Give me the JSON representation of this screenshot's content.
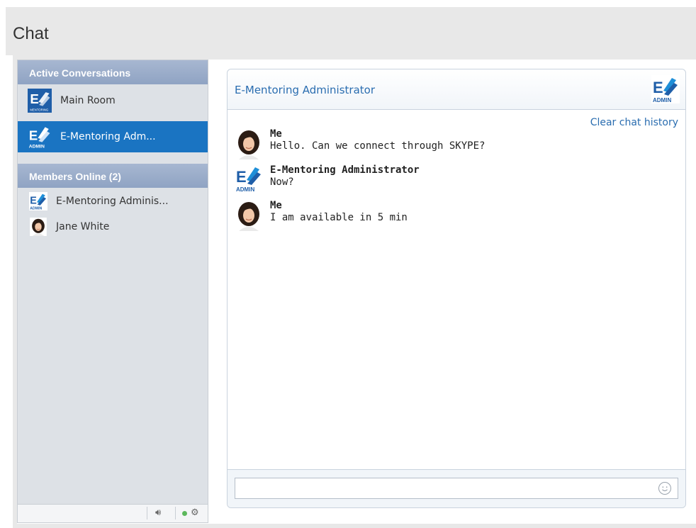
{
  "page": {
    "title": "Chat"
  },
  "sidebar": {
    "active_header": "Active Conversations",
    "conversations": [
      {
        "label": "Main Room",
        "icon": "mentoring-logo-icon"
      },
      {
        "label": "E-Mentoring Adm...",
        "icon": "admin-logo-icon",
        "active": true
      }
    ],
    "members_header": "Members Online (2)",
    "members": [
      {
        "label": "E-Mentoring Adminis...",
        "icon": "admin-logo-icon"
      },
      {
        "label": "Jane White",
        "icon": "user-avatar-icon"
      }
    ],
    "footer": {
      "sound_icon": "speaker-icon",
      "status_color": "#5cb85c",
      "settings_icon": "gear-icon"
    }
  },
  "chat": {
    "title": "E-Mentoring Administrator",
    "clear_history": "Clear chat history",
    "messages": [
      {
        "author": "Me",
        "text": "Hello. Can we connect through SKYPE?",
        "avatar": "user-avatar-icon"
      },
      {
        "author": "E-Mentoring Administrator",
        "text": "Now?",
        "avatar": "admin-logo-icon"
      },
      {
        "author": "Me",
        "text": "I am available in 5 min",
        "avatar": "user-avatar-icon"
      }
    ],
    "input": {
      "value": "",
      "placeholder": ""
    }
  },
  "colors": {
    "accent": "#1a74c2",
    "header_blue": "#8fa3c3",
    "link": "#2a6db0"
  }
}
